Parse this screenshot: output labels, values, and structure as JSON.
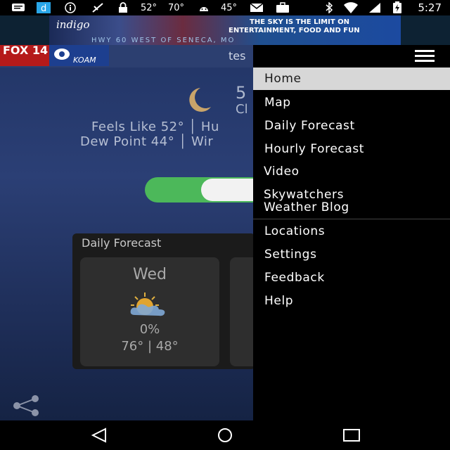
{
  "status_bar": {
    "temp1": "52°",
    "temp2": "70°",
    "temp3": "45°",
    "time": "5:27"
  },
  "ad": {
    "logo": "indigo",
    "line1": "THE SKY IS THE LIMIT ON",
    "line2": "ENTERTAINMENT, FOOD AND FUN",
    "line3": "HWY 60 WEST OF SENECA, MO"
  },
  "header": {
    "logo_left": "FOX 14",
    "logo_right": "KOAM",
    "title_partial": "tes"
  },
  "current": {
    "temp_partial": "5",
    "cond_partial": "Cl",
    "feels_text": "Feels Like  52° │ Hu",
    "dew_text": "Dew Point  44° │ Wir"
  },
  "daily": {
    "title": "Daily Forecast",
    "cards": [
      {
        "day": "Wed",
        "precip": "0%",
        "temps": "76° | 48°",
        "icon": "partly-cloudy-icon"
      }
    ]
  },
  "drawer": {
    "items": [
      {
        "label": "Home",
        "selected": true
      },
      {
        "label": "Map"
      },
      {
        "label": "Daily Forecast"
      },
      {
        "label": "Hourly Forecast"
      },
      {
        "label": "Video"
      },
      {
        "label_line1": "Skywatchers",
        "label_line2": "Weather Blog"
      },
      {
        "label": "Locations"
      },
      {
        "label": "Settings"
      },
      {
        "label": "Feedback"
      },
      {
        "label": "Help"
      }
    ]
  },
  "colors": {
    "toggle_on": "#4cb85a",
    "selected_bg": "#d7d7d7",
    "drawer_bg": "#000000"
  }
}
